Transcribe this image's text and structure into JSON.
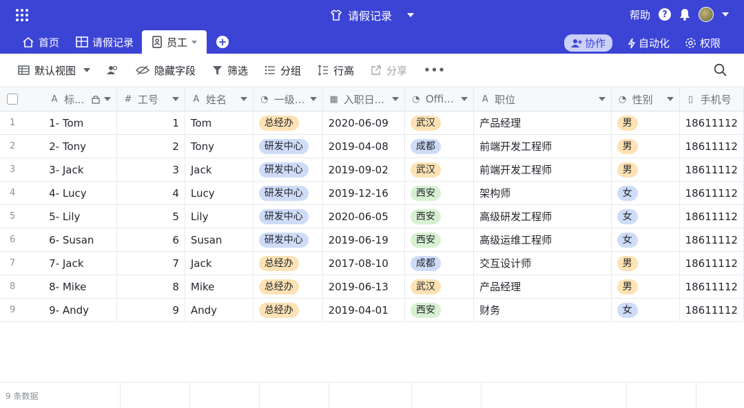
{
  "header": {
    "title": "请假记录",
    "help_label": "帮助",
    "help_mark": "?",
    "add_tab_mark": "+"
  },
  "tabs": [
    {
      "label": "首页",
      "icon": "home-icon"
    },
    {
      "label": "请假记录",
      "icon": "table-icon"
    },
    {
      "label": "员工",
      "icon": "contact-icon",
      "active": true
    }
  ],
  "header_actions": {
    "collab": "协作",
    "automation": "自动化",
    "permissions": "权限"
  },
  "toolbar": {
    "view": "默认视图",
    "hide_fields": "隐藏字段",
    "filter": "筛选",
    "group": "分组",
    "row_height": "行高",
    "share": "分享",
    "more": "•••"
  },
  "columns": [
    {
      "label": "标...",
      "type_icon": "text-icon"
    },
    {
      "label": "工号",
      "type_icon": "number-icon"
    },
    {
      "label": "姓名",
      "type_icon": "text-icon"
    },
    {
      "label": "一级...",
      "type_icon": "single-select-icon"
    },
    {
      "label": "入职日...",
      "type_icon": "date-icon"
    },
    {
      "label": "Offi...",
      "type_icon": "single-select-icon"
    },
    {
      "label": "职位",
      "type_icon": "text-icon"
    },
    {
      "label": "性别",
      "type_icon": "single-select-icon"
    },
    {
      "label": "手机号",
      "type_icon": "phone-icon"
    }
  ],
  "rows": [
    {
      "n": "1",
      "title": "1- Tom",
      "id": "1",
      "name": "Tom",
      "dept": "总经办",
      "date": "2020-06-09",
      "office": "武汉",
      "position": "产品经理",
      "gender": "男",
      "phone": "18611112"
    },
    {
      "n": "2",
      "title": "2- Tony",
      "id": "2",
      "name": "Tony",
      "dept": "研发中心",
      "date": "2019-04-08",
      "office": "成都",
      "position": "前端开发工程师",
      "gender": "男",
      "phone": "18611112"
    },
    {
      "n": "3",
      "title": "3- Jack",
      "id": "3",
      "name": "Jack",
      "dept": "研发中心",
      "date": "2019-09-02",
      "office": "武汉",
      "position": "前端开发工程师",
      "gender": "男",
      "phone": "18611112"
    },
    {
      "n": "4",
      "title": "4- Lucy",
      "id": "4",
      "name": "Lucy",
      "dept": "研发中心",
      "date": "2019-12-16",
      "office": "西安",
      "position": "架构师",
      "gender": "女",
      "phone": "18611112"
    },
    {
      "n": "5",
      "title": "5- Lily",
      "id": "5",
      "name": "Lily",
      "dept": "研发中心",
      "date": "2020-06-05",
      "office": "西安",
      "position": "高级研发工程师",
      "gender": "女",
      "phone": "18611112"
    },
    {
      "n": "6",
      "title": "6- Susan",
      "id": "6",
      "name": "Susan",
      "dept": "研发中心",
      "date": "2019-06-19",
      "office": "西安",
      "position": "高级运维工程师",
      "gender": "女",
      "phone": "18611112"
    },
    {
      "n": "7",
      "title": "7- Jack",
      "id": "7",
      "name": "Jack",
      "dept": "总经办",
      "date": "2017-08-10",
      "office": "成都",
      "position": "交互设计师",
      "gender": "男",
      "phone": "18611112"
    },
    {
      "n": "8",
      "title": "8- Mike",
      "id": "8",
      "name": "Mike",
      "dept": "总经办",
      "date": "2019-06-13",
      "office": "武汉",
      "position": "产品经理",
      "gender": "男",
      "phone": "18611112"
    },
    {
      "n": "9",
      "title": "9- Andy",
      "id": "9",
      "name": "Andy",
      "dept": "总经办",
      "date": "2019-04-01",
      "office": "西安",
      "position": "财务",
      "gender": "女",
      "phone": "18611112"
    }
  ],
  "footer": {
    "count": "9 条数据"
  },
  "pill_colors": {
    "总经办": "#fde2b4",
    "研发中心": "#cfdcf8",
    "武汉": "#fde2b4",
    "成都": "#cfdcf8",
    "西安": "#d7f0d2",
    "男": "#fde2b4",
    "女": "#cfdcf8"
  },
  "colors": {
    "brand": "#3c44d6"
  }
}
